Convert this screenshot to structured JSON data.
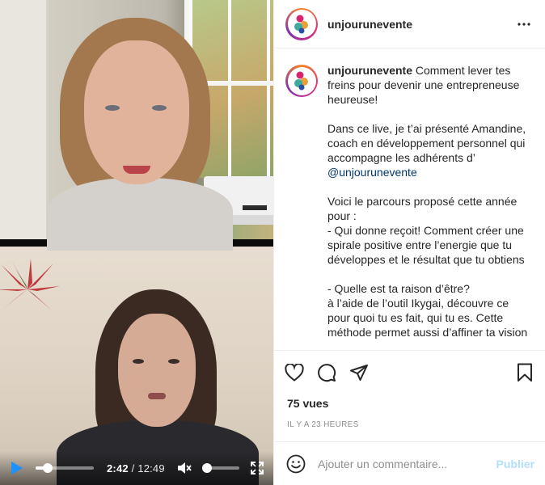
{
  "post": {
    "username": "unjourunevente",
    "caption": {
      "intro": "Comment lever tes freins pour devenir une entrepreneuse heureuse!",
      "para2": "Dans ce live, je t’ai présenté Amandine, coach en développement personnel qui accompagne les adhérents d’",
      "mention": "@unjourunevente",
      "para3_line1": "Voici le parcours proposé cette année pour :",
      "para3_line2": "- Qui donne reçoit! Comment créer une spirale positive entre l’energie que tu développes et le résultat que tu obtiens",
      "para4_line1": "- Quelle est ta raison d’être?",
      "para4_line2": "à l’aide de l’outil Ikygai, découvre ce pour quoi tu es fait, qui tu es. Cette méthode permet aussi d’affiner ta vision"
    },
    "views": "75 vues",
    "posted_ago": "IL Y A 23 HEURES"
  },
  "video": {
    "current_time": "2:42",
    "separator": " / ",
    "duration": "12:49",
    "progress": 0.21,
    "volume": 0.1
  },
  "comment_box": {
    "placeholder": "Ajouter un commentaire...",
    "publish_label": "Publier"
  },
  "colors": {
    "link": "#00376b",
    "publish_disabled": "#b2dffc",
    "muted": "#8e8e8e"
  },
  "icons": [
    "play-icon",
    "mute-icon",
    "fullscreen-icon",
    "more-icon",
    "heart-icon",
    "comment-icon",
    "share-icon",
    "bookmark-icon",
    "emoji-icon"
  ]
}
